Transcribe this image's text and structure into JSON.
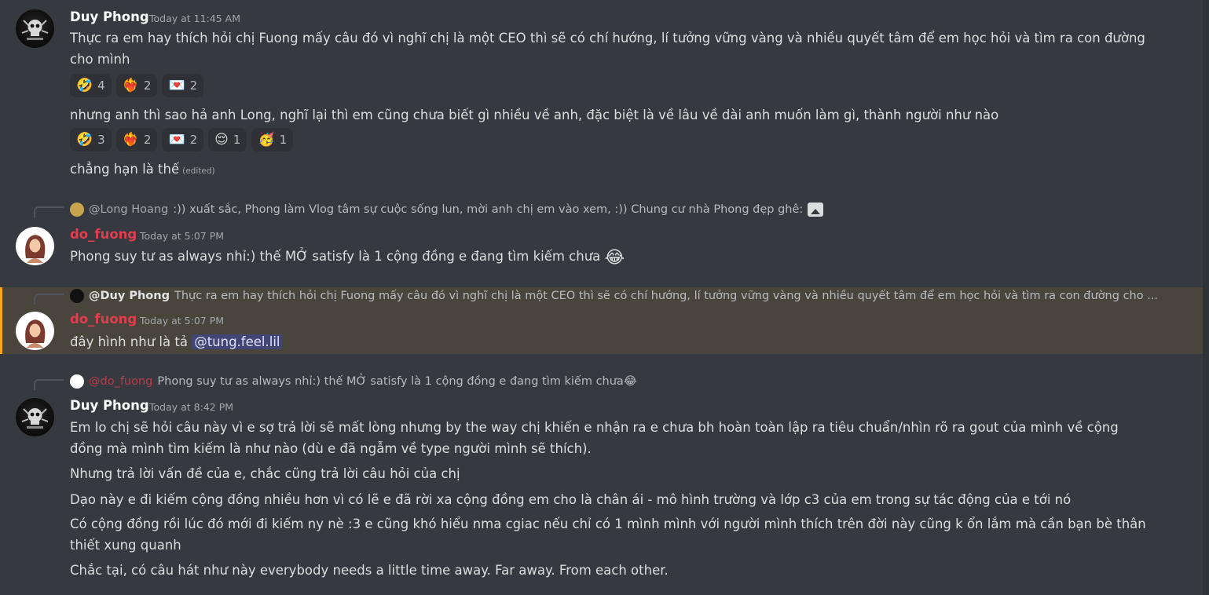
{
  "messages": {
    "m1": {
      "author": "Duy Phong",
      "time": "Today at 11:45 AM",
      "text1": "Thực ra em hay thích hỏi chị Fuong mấy câu đó vì nghĩ chị là một CEO thì sẽ có chí hướng, lí tưởng vững vàng và nhiều quyết tâm để em học hỏi và tìm ra con đường",
      "text1b": "cho mình",
      "reactions1": [
        {
          "emoji": "🤣",
          "count": "4"
        },
        {
          "emoji": "❤️‍🔥",
          "count": "2"
        },
        {
          "emoji": "💌",
          "count": "2"
        }
      ],
      "text2": "nhưng anh thì sao hả anh Long, nghĩ lại thì em cũng chưa biết gì nhiều về anh, đặc biệt là về lâu về dài anh muốn làm gì, thành người như nào",
      "reactions2": [
        {
          "emoji": "🤣",
          "count": "3"
        },
        {
          "emoji": "❤️‍🔥",
          "count": "2"
        },
        {
          "emoji": "💌",
          "count": "2"
        },
        {
          "emoji": "😌",
          "count": "1"
        },
        {
          "emoji": "🥳",
          "count": "1"
        }
      ],
      "text3": "chẳng hạn là thế",
      "edited": "(edited)"
    },
    "m2": {
      "reply_mention": "@Long Hoang",
      "reply_text": ":)) xuất sắc, Phong làm Vlog tâm sự cuộc sống lun, mời anh chị em vào xem, :)) Chung cư nhà Phong đẹp ghê:",
      "author": "do_fuong",
      "time": "Today at 5:07 PM",
      "text": "Phong suy tư as always nhỉ:) thế MỞ satisfy là 1 cộng đồng e đang tìm kiếm chưa",
      "emoji": "😂"
    },
    "m3": {
      "reply_mention": "@Duy Phong",
      "reply_text": "Thực ra em hay thích hỏi chị Fuong mấy câu đó vì nghĩ chị là một CEO thì sẽ có chí hướng, lí tưởng vững vàng và nhiều quyết tâm để em học hỏi và tìm ra con đường cho ...",
      "author": "do_fuong",
      "time": "Today at 5:07 PM",
      "text": "đây hình như là tả",
      "mention": "@tung.feel.lil"
    },
    "m4": {
      "reply_mention": "@do_fuong",
      "reply_text": "Phong suy tư as always nhỉ:) thế MỞ satisfy là 1 cộng đồng e đang tìm kiếm chưa",
      "reply_emoji": "😂",
      "author": "Duy Phong",
      "time": "Today at 8:42 PM",
      "line1": "Em lo chị sẽ hỏi câu này vì e sợ trả lời sẽ mất lòng nhưng by the way chị khiến e nhận ra e chưa bh hoàn toàn lập ra tiêu chuẩn/nhìn rõ ra gout của mình về cộng",
      "line1b": "đồng mà mình tìm kiếm là như nào (dù e đã ngẫm về type người mình sẽ thích).",
      "line2": "Nhưng trả lời vấn đề của e, chắc cũng trả lời câu hỏi của chị",
      "line3": "Dạo này e đi kiếm cộng đồng nhiều hơn vì có lẽ e đã rời xa cộng đồng em cho là chân ái - mô hình trường và lớp c3 của em trong sự tác động của e tới nó",
      "line4": "Có cộng đồng rồi lúc đó mới đi kiếm ny nè :3 e cũng khó hiểu nma cgiac nếu chỉ có 1 mình mình với người mình thích trên đời này cũng k ổn lắm mà cần bạn bè thân",
      "line4b": "thiết xung quanh",
      "line5": "Chắc tại, có câu hát như này everybody needs a little time away. Far away. From each other."
    }
  },
  "colors": {
    "background": "#36393f",
    "highlight_bg": "#49443c",
    "highlight_bar": "#faa61a",
    "do_fuong_name": "#e03e4e",
    "mention_bg": "#414675"
  },
  "icons": {
    "attachment": "image-icon"
  }
}
